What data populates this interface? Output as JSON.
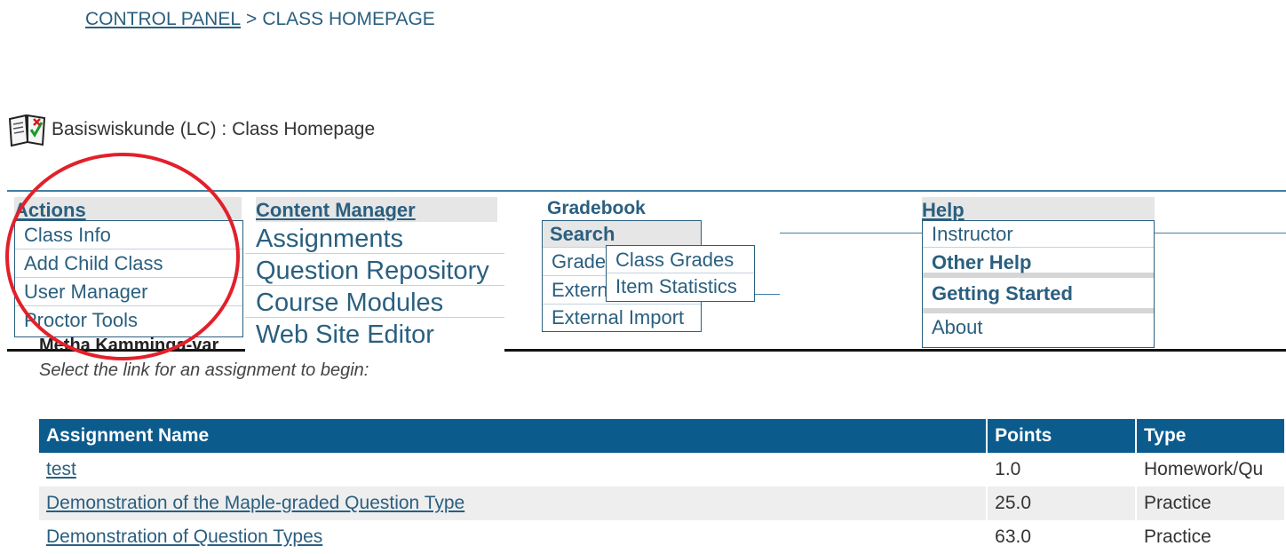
{
  "breadcrumb": {
    "link": "CONTROL PANEL",
    "separator": ">",
    "current": "CLASS HOMEPAGE"
  },
  "page_title": "Basiswiskunde (LC) : Class Homepage",
  "menus": {
    "actions": {
      "label": "Actions",
      "items": [
        "Class Info",
        "Add Child Class",
        "User Manager",
        "Proctor Tools"
      ]
    },
    "content_manager": {
      "label": "Content Manager",
      "items": [
        "Assignments",
        "Question Repository",
        "Course Modules",
        "Web Site Editor"
      ]
    },
    "gradebook": {
      "label": "Gradebook",
      "submenu_head": "Search",
      "items": [
        "Grade",
        "Extern",
        "External Import"
      ],
      "flyout": [
        "Class Grades",
        "Item Statistics"
      ]
    },
    "help": {
      "label": "Help",
      "items": [
        "Instructor",
        "Other Help",
        "Getting Started",
        "About"
      ]
    }
  },
  "overlap_text": "Metha Kamminga-var",
  "subtitle": "Select the link for an assignment to begin:",
  "table": {
    "headers": [
      "Assignment Name",
      "Points",
      "Type"
    ],
    "rows": [
      {
        "name": "test",
        "points": "1.0",
        "type": "Homework/Qu"
      },
      {
        "name": "Demonstration of the Maple-graded Question Type",
        "points": "25.0",
        "type": "Practice"
      },
      {
        "name": "Demonstration of Question Types",
        "points": "63.0",
        "type": "Practice"
      }
    ]
  },
  "colors": {
    "header_bg": "#0c5b8d",
    "link": "#2a5f7f",
    "annotation": "#e2202a"
  }
}
